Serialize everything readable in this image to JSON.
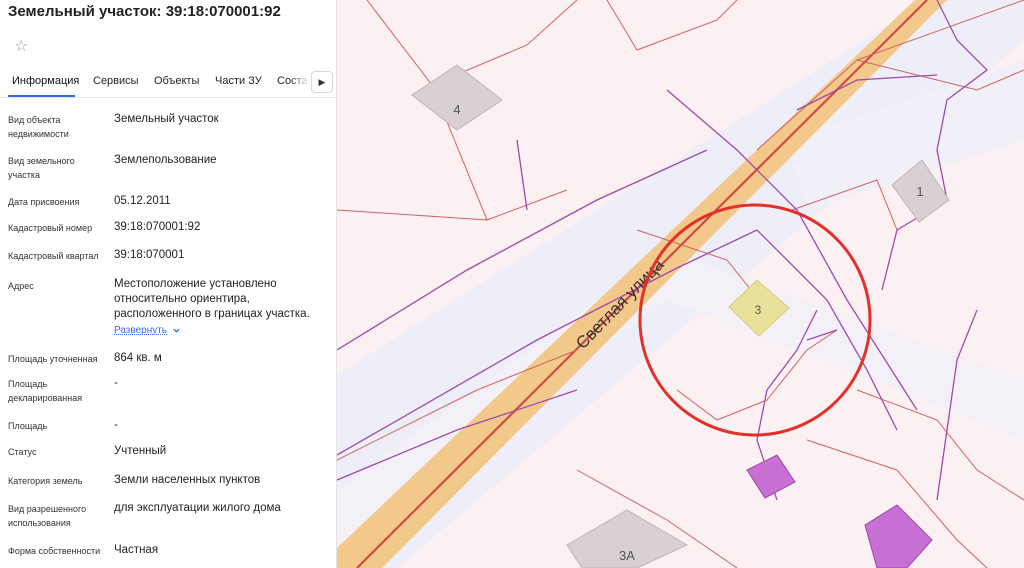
{
  "panel": {
    "title": "Земельный участок: 39:18:070001:92",
    "tabs": [
      "Информация",
      "Сервисы",
      "Объекты",
      "Части ЗУ",
      "Состав"
    ],
    "fields": [
      {
        "label": "Вид объекта недвижимости",
        "value": "Земельный участок"
      },
      {
        "label": "Вид земельного участка",
        "value": "Землепользование"
      },
      {
        "label": "Дата присвоения",
        "value": "05.12.2011"
      },
      {
        "label": "Кадастровый номер",
        "value": "39:18:070001:92"
      },
      {
        "label": "Кадастровый квартал",
        "value": "39:18:070001"
      },
      {
        "label": "Адрес",
        "value": "Местоположение установлено относительно ориентира, расположенного в границах участка."
      },
      {
        "label": "Площадь уточненная",
        "value": "864 кв. м"
      },
      {
        "label": "Площадь декларированная",
        "value": "-"
      },
      {
        "label": "Площадь",
        "value": "-"
      },
      {
        "label": "Статус",
        "value": "Учтенный"
      },
      {
        "label": "Категория земель",
        "value": "Земли населенных пунктов"
      },
      {
        "label": "Вид разрешенного использования",
        "value": "для эксплуатации жилого дома"
      },
      {
        "label": "Форма собственности",
        "value": "Частная"
      }
    ],
    "expand_label": "Развернуть"
  },
  "map": {
    "street_name": "Светлая улица",
    "building_labels": [
      "4",
      "1",
      "3",
      "3А"
    ],
    "colors": {
      "parcel_fill": "#fbf0f2",
      "road_fill": "#eeeef8",
      "street_band": "#f3c88b",
      "building_gray": "#d9d0d3",
      "building_yellow": "#e9e19a",
      "building_purple": "#c86fd3",
      "boundary_red": "#cf6060",
      "boundary_purple": "#a04aa8",
      "highlight_circle": "#e2312a",
      "accent": "#2f6fdf"
    },
    "icons": [
      "star-icon",
      "chevron-right-icon",
      "chevron-down-icon"
    ]
  }
}
